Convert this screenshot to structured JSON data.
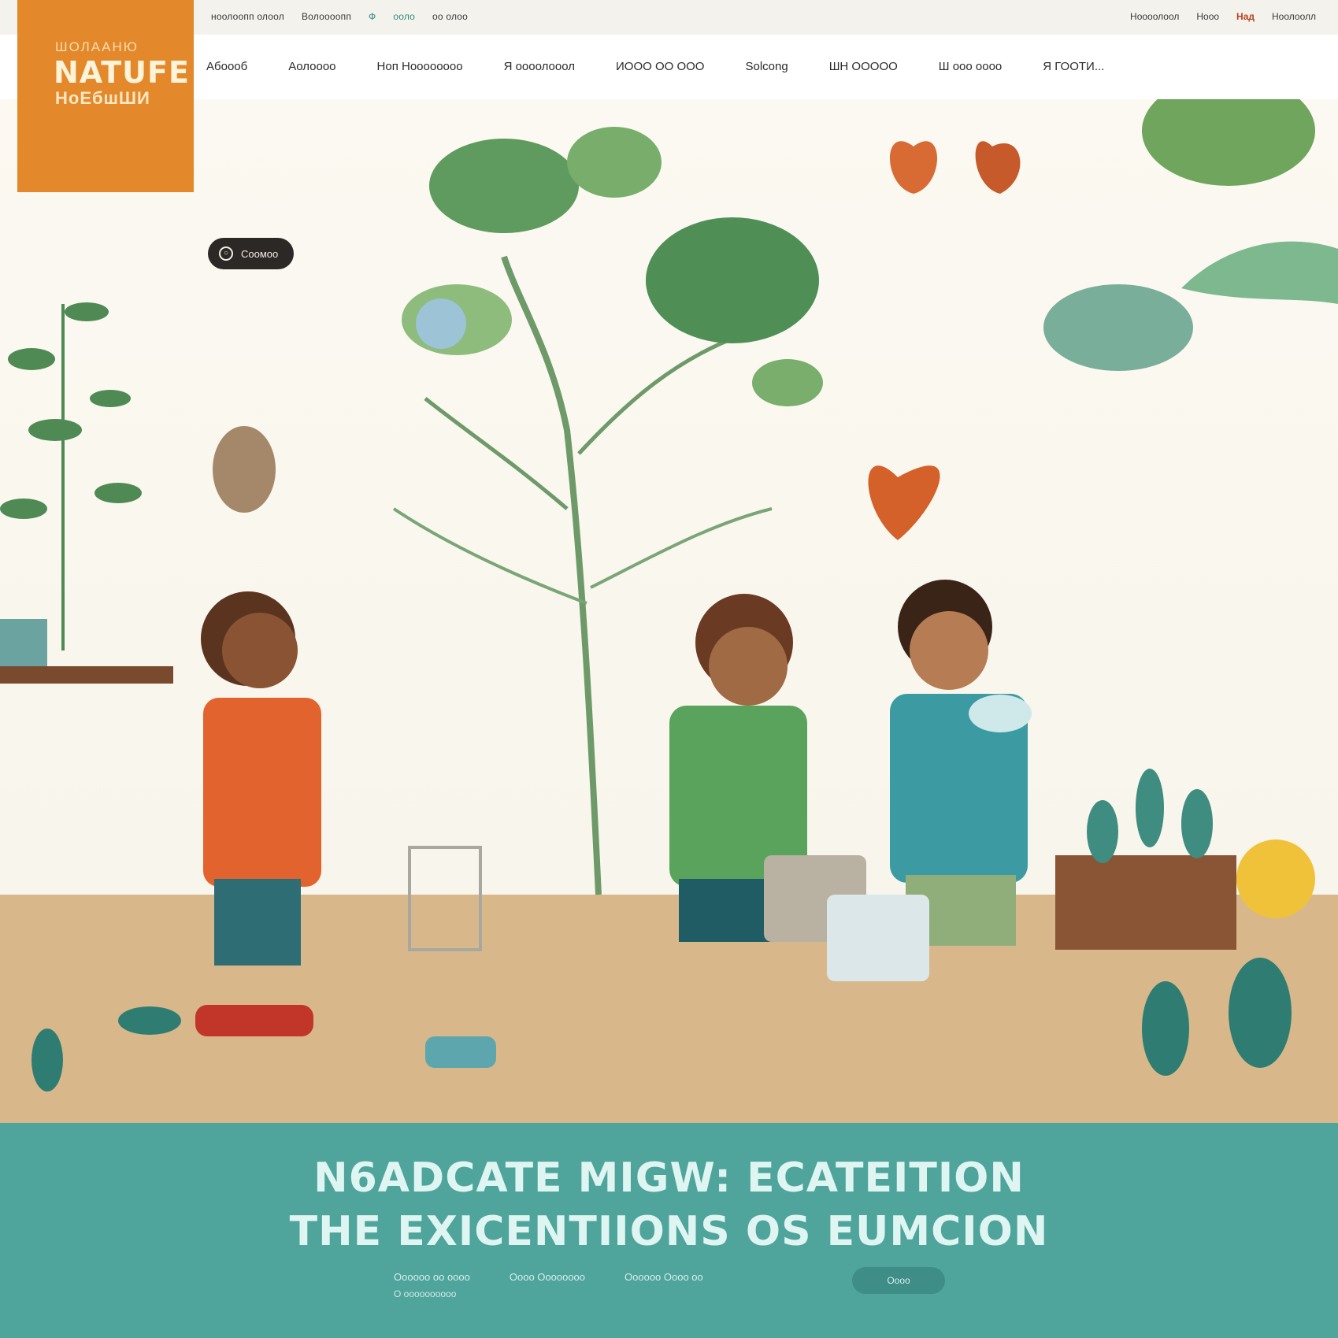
{
  "utility": {
    "left": [
      "ноолоопп олоол",
      "Волоооопп",
      "Ф",
      "ооло",
      "оо олоо"
    ],
    "right": [
      "Ноооолоол",
      "Нооо",
      "Над",
      "Ноолоолл"
    ]
  },
  "logo": {
    "small": "ШОЛААНЮ",
    "big": "NATUFE",
    "sub": "НоЕбшШИ"
  },
  "nav": [
    "Абоооб",
    "Аолоооо",
    "Ноп Ноооооооо",
    "Я оооолооол",
    "ИООО ОО ООО",
    "Solcong",
    "ШН ООООО",
    "Ш ооо оооо",
    "Я ГООТИ..."
  ],
  "hero": {
    "pill_label": "Соомоо"
  },
  "banner": {
    "line1": "N6ADCATE MIGW: ECATEITION",
    "line2": "THE EXICENTIIONS OS EUMCION",
    "links": [
      "Оооооо оо оооо",
      "Оооо Оооооооо",
      "Оооооо Оооо оо"
    ],
    "links_sub": "О оооооооооо",
    "cta": "Оооо"
  },
  "colors": {
    "logo_bg": "#e4892b",
    "banner_bg": "#4fa49c",
    "pill_bg": "#2c2826"
  }
}
